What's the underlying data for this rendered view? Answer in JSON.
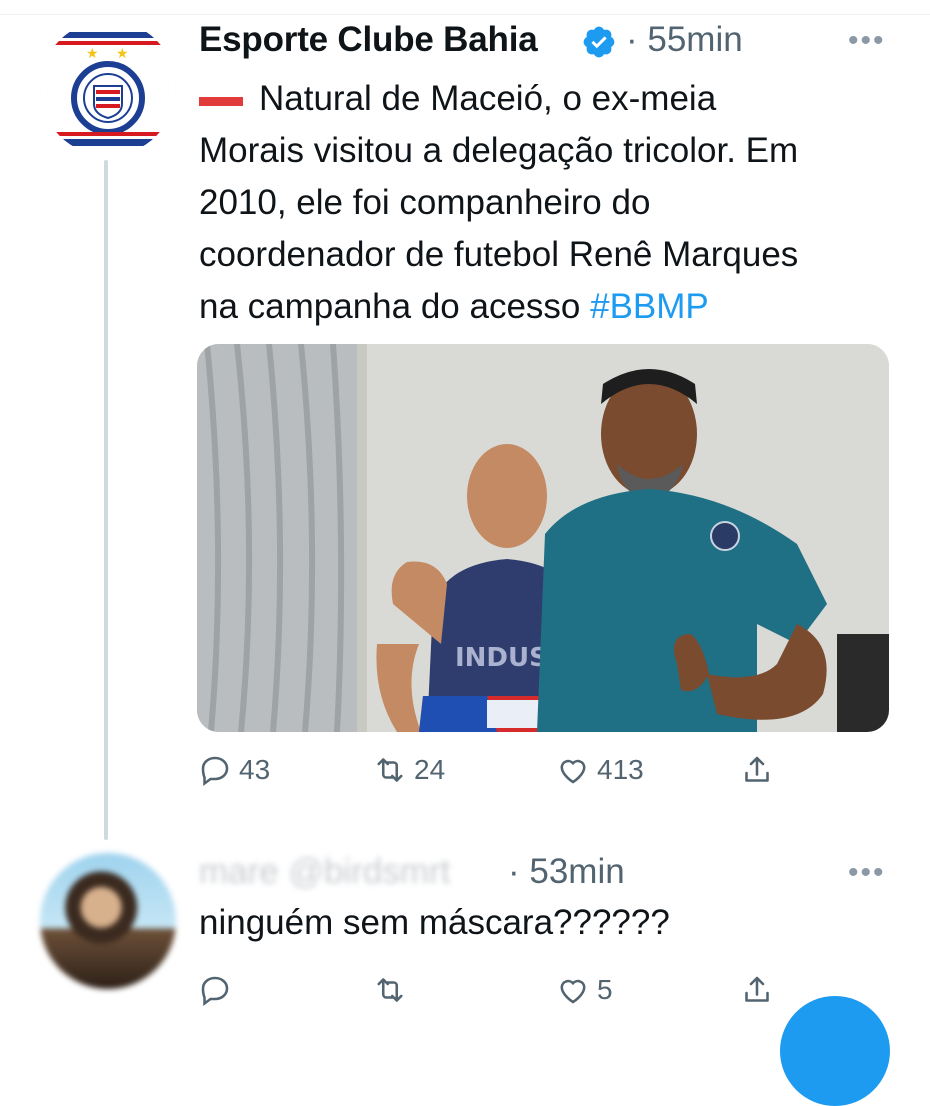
{
  "tweet": {
    "author_name": "Esporte Clube Bahia",
    "time": "· 55min",
    "more_label": "•••",
    "text_lines": [
      "Natural de Maceió, o ex-meia",
      "Morais visitou a delegação tricolor. Em",
      "2010, ele foi companheiro do",
      "coordenador de futebol Renê Marques",
      "na campanha do acesso "
    ],
    "hashtag": "#BBMP",
    "flag_icon": "flag-icon",
    "counts": {
      "replies": "43",
      "retweets": "24",
      "likes": "413"
    }
  },
  "reply": {
    "author_blurred": "mare @birdsmrt",
    "time": "· 53min",
    "more_label": "•••",
    "text": "ninguém sem máscara??????",
    "counts": {
      "likes": "5"
    }
  },
  "colors": {
    "accent": "#1d9bf0",
    "muted": "#536471",
    "text": "#0f1419"
  }
}
